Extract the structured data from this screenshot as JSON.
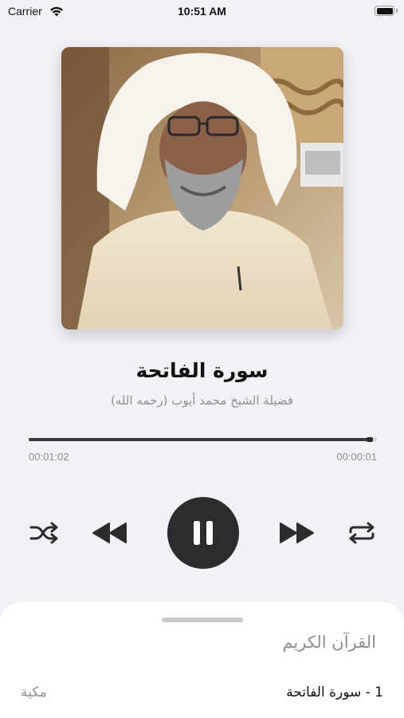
{
  "status_bar": {
    "carrier": "Carrier",
    "time": "10:51 AM"
  },
  "now_playing": {
    "title": "سورة الفاتحة",
    "reciter": "فضيلة الشيخ محمد أيوب (رحمه الله)",
    "elapsed": "00:01:02",
    "remaining": "00:00:01",
    "progress": 0.98
  },
  "controls": {
    "shuffle": "shuffle-icon",
    "previous": "backward-icon",
    "play_pause": "pause-icon",
    "next": "forward-icon",
    "repeat": "repeat-icon"
  },
  "playlist": {
    "title": "القرآن الكريم",
    "items": [
      {
        "label": "1 -  سورة الفاتحة",
        "type": "مكية"
      }
    ]
  },
  "colors": {
    "background": "#f2f2f6",
    "control": "#2c2c2e",
    "secondary_text": "#8e8e93"
  }
}
